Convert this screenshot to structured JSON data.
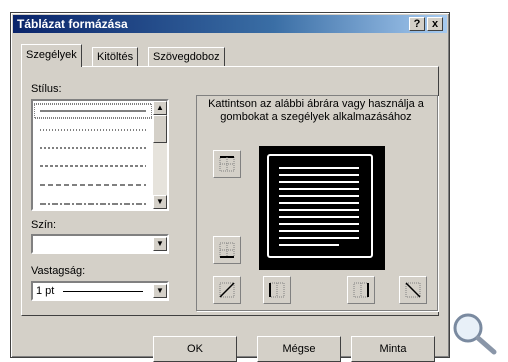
{
  "dialog": {
    "title": "Táblázat formázása",
    "help_btn": "?",
    "close_btn": "x"
  },
  "tabs": [
    {
      "label": "Szegélyek",
      "active": true
    },
    {
      "label": "Kitöltés",
      "active": false
    },
    {
      "label": "Szövegdoboz",
      "active": false
    }
  ],
  "style": {
    "label": "Stílus:"
  },
  "color": {
    "label": "Szín:",
    "value": ""
  },
  "thickness": {
    "label": "Vastagság:",
    "value": "1 pt"
  },
  "preview": {
    "instruction": "Kattintson az alábbi ábrára vagy használja a gombokat a szegélyek alkalmazásához"
  },
  "buttons": {
    "ok": "OK",
    "cancel": "Mégse",
    "sample": "Minta"
  },
  "colors": {
    "preview_bg": "#000000",
    "titlebar_start": "#0a246a"
  }
}
